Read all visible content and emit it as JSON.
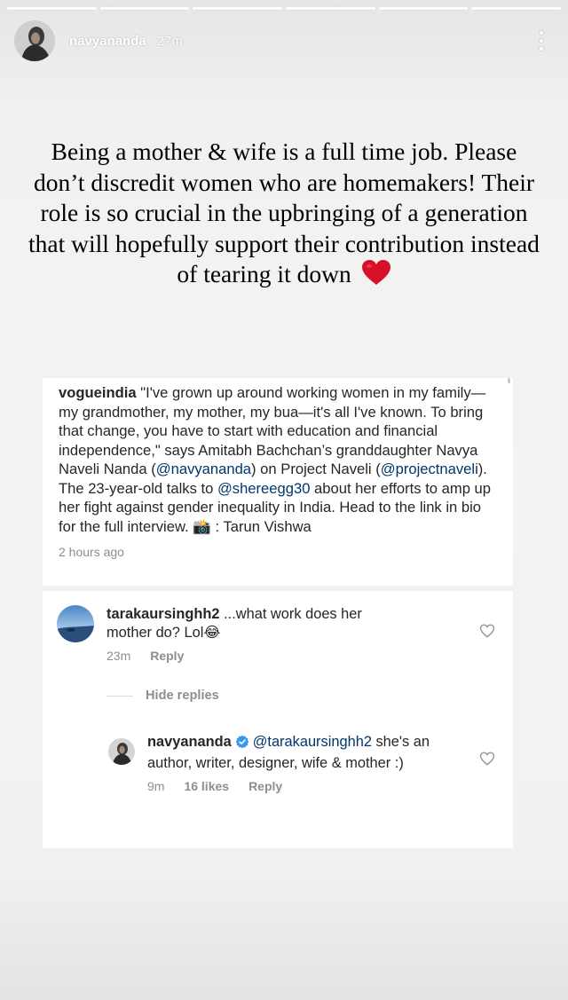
{
  "story": {
    "username": "navyananda",
    "time": "27m",
    "caption": "Being a mother & wife is a full time job. Please don’t discredit women who are homemakers! Their role is so crucial in the upbringing of a generation that will hopefully support their contribution instead of tearing it down",
    "heart_icon": "red-heart-emoji"
  },
  "post": {
    "username": "vogueindia",
    "text_1": " \"I've grown up around working women in my family—my grandmother, my mother, my bua—it's all I've known. To bring that change, you have to start with education and financial independence,\" says Amitabh Bachchan’s granddaughter Navya Naveli Nanda (",
    "mention_1": "@navyananda",
    "text_2": ") on Project Naveli (",
    "mention_2": "@projectnaveli",
    "text_3": "). The 23-year-old talks to ",
    "mention_3": "@shereegg30",
    "text_4": " about her efforts to amp up her fight against gender inequality in India. Head to the link in bio for the full interview. ",
    "camera_emoji": "📸",
    "text_5": " : Tarun Vishwa",
    "time": "2 hours ago"
  },
  "comments": [
    {
      "username": "tarakaursinghh2",
      "text": " ...what work does her mother do? Lol",
      "emoji": "😂",
      "time": "23m",
      "reply_label": "Reply"
    }
  ],
  "hide_replies_label": "Hide replies",
  "reply": {
    "username": "navyananda",
    "mention": "@tarakaursinghh2",
    "text": " she's an author, writer, designer, wife & mother :)",
    "time": "9m",
    "likes": "16 likes",
    "reply_label": "Reply"
  },
  "colors": {
    "link": "#00376b",
    "meta": "#8e8e8e",
    "verified": "#3897f0",
    "heart": "#d8102a"
  }
}
